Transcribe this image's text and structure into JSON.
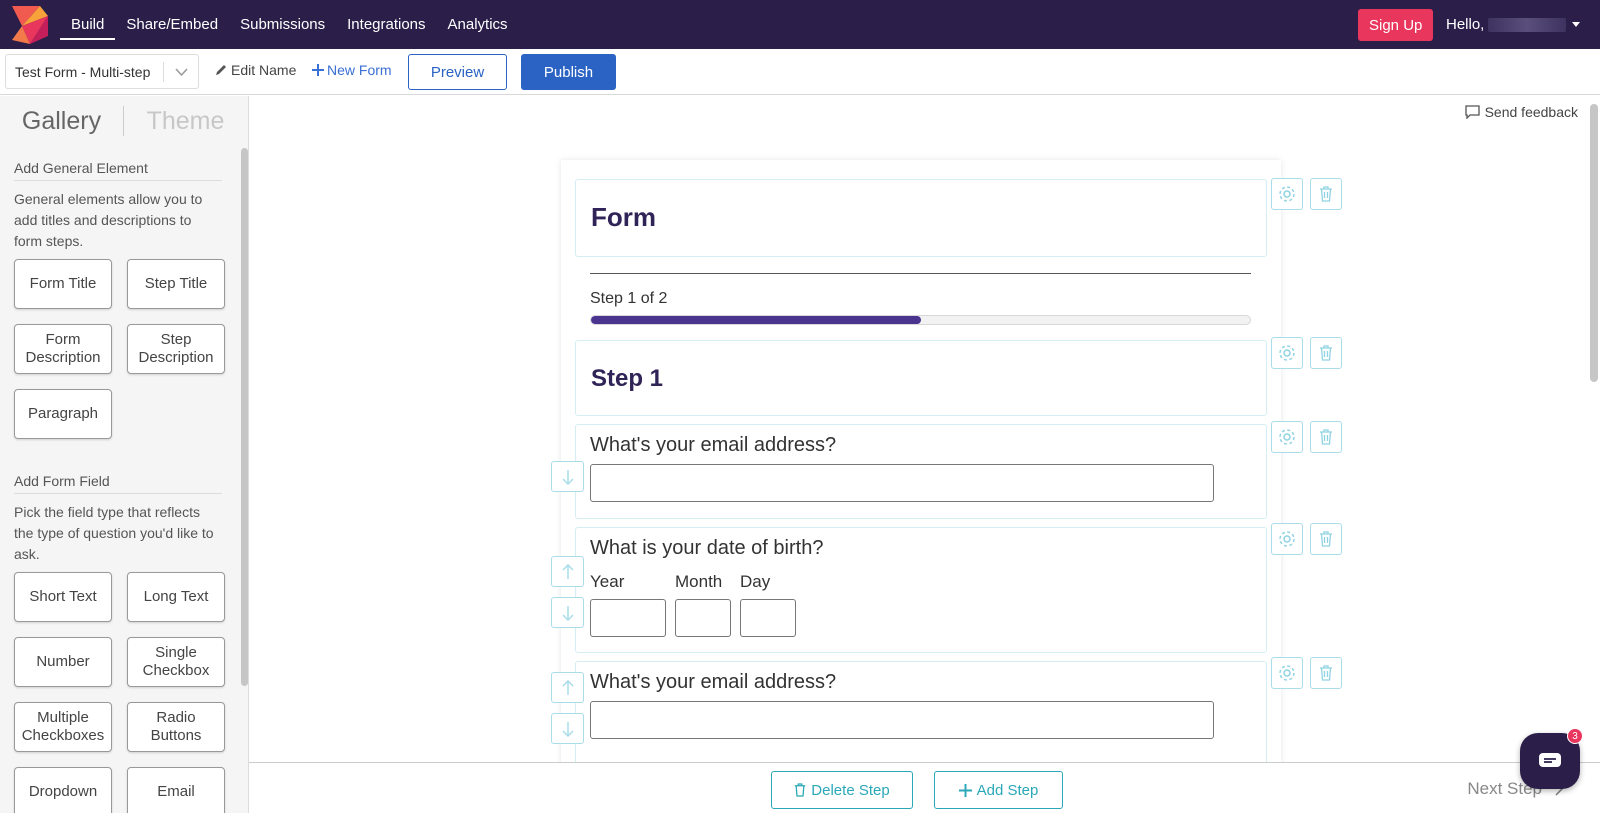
{
  "nav": {
    "links": [
      "Build",
      "Share/Embed",
      "Submissions",
      "Integrations",
      "Analytics"
    ],
    "active": "Build",
    "signup_label": "Sign Up",
    "hello_label": "Hello,",
    "colors": {
      "bar": "#2b1f4a",
      "signup": "#e8365d"
    }
  },
  "toolbar": {
    "form_name": "Test Form - Multi-step",
    "edit_name_label": "Edit Name",
    "new_form_label": "New Form",
    "preview_label": "Preview",
    "publish_label": "Publish"
  },
  "sidebar": {
    "tabs": [
      "Gallery",
      "Theme"
    ],
    "general": {
      "heading": "Add General Element",
      "description": "General elements allow you to add titles and descriptions to form steps.",
      "buttons": [
        "Form Title",
        "Step Title",
        "Form Description",
        "Step Description",
        "Paragraph"
      ]
    },
    "fields": {
      "heading": "Add Form Field",
      "description": "Pick the field type that reflects the type of question you'd like to ask.",
      "buttons": [
        "Short Text",
        "Long Text",
        "Number",
        "Single Checkbox",
        "Multiple Checkboxes",
        "Radio Buttons",
        "Dropdown",
        "Email"
      ]
    }
  },
  "canvas": {
    "feedback_label": "Send feedback",
    "form_title": "Form",
    "progress": {
      "label": "Step 1 of 2",
      "percent": 50,
      "color": "#4a3490"
    },
    "step_title": "Step 1",
    "questions": [
      {
        "label": "What's your email address?"
      },
      {
        "label": "What is your date of birth?",
        "sub_labels": [
          "Year",
          "Month",
          "Day"
        ]
      },
      {
        "label": "What's your email address?"
      }
    ]
  },
  "bottom": {
    "delete_step_label": "Delete Step",
    "add_step_label": "Add Step",
    "next_step_label": "Next Step"
  },
  "chat": {
    "badge_count": "3"
  },
  "icons": [
    "logo-icon",
    "pencil-icon",
    "plus-icon",
    "chevron-down-icon",
    "feedback-icon",
    "gear-icon",
    "trash-icon",
    "arrow-up-icon",
    "arrow-down-icon",
    "chevron-right-icon",
    "chat-icon"
  ]
}
